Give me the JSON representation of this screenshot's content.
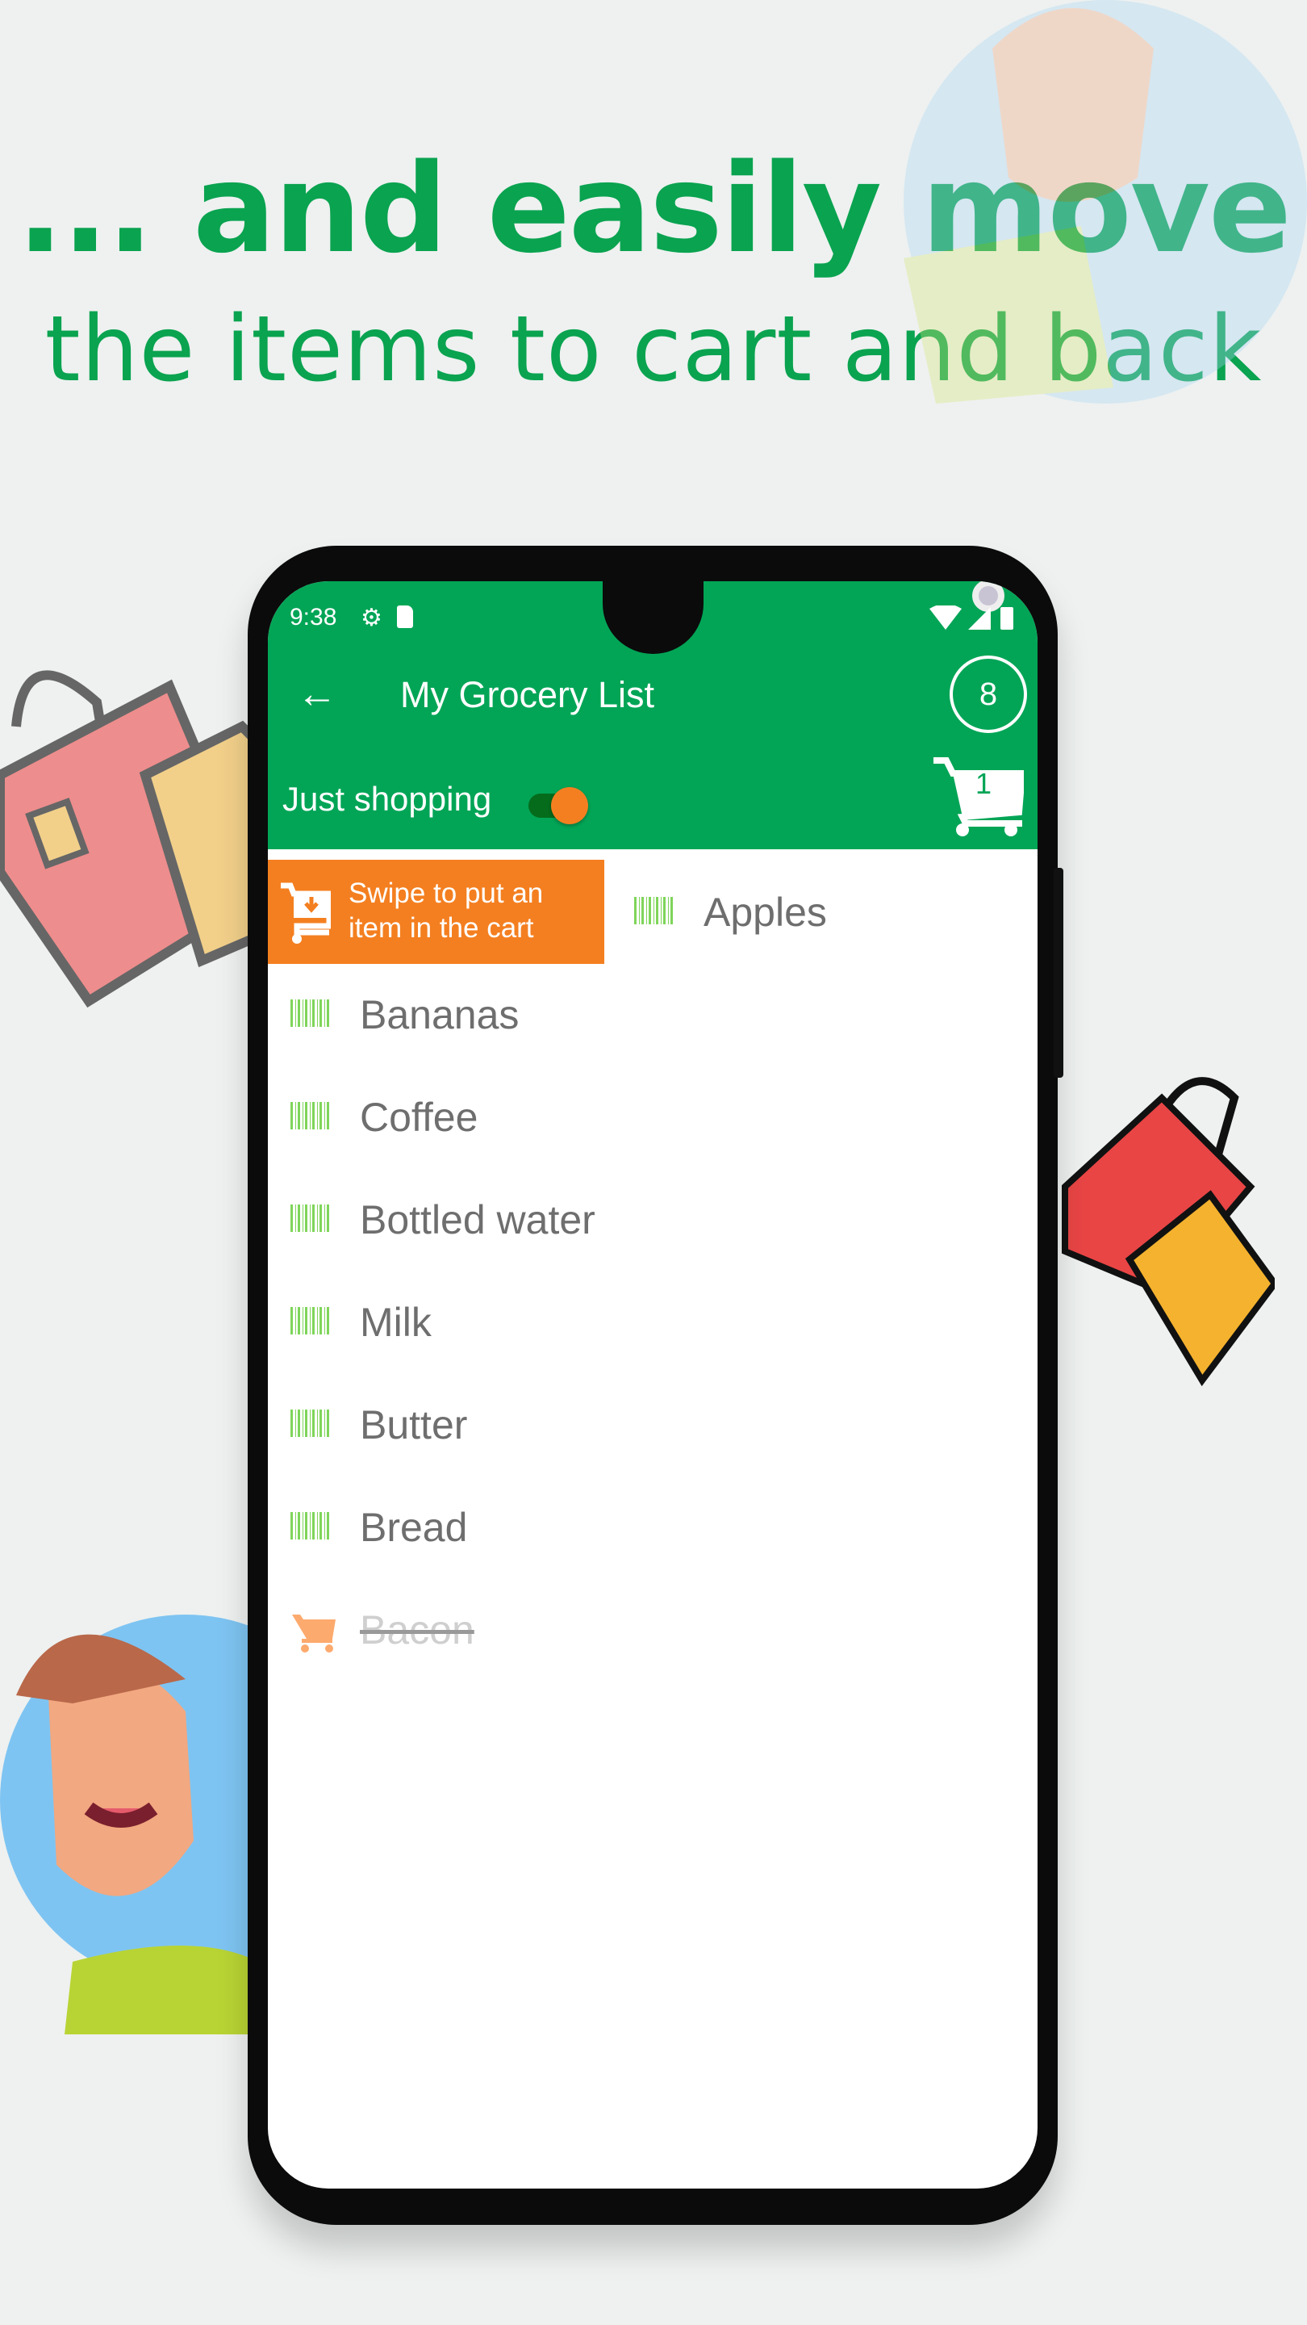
{
  "headline": {
    "line1": "... and easily move",
    "line2": "the items to cart and back"
  },
  "status": {
    "time": "9:38"
  },
  "toolbar": {
    "title": "My Grocery List",
    "count": "8",
    "cart_count": "1"
  },
  "mode": {
    "label": "Just shopping",
    "toggle_on": true
  },
  "swipe_hint": {
    "line1": "Swipe to put an",
    "line2": "item in the cart"
  },
  "items": [
    {
      "name": "Apples",
      "in_cart": false
    },
    {
      "name": "Bananas",
      "in_cart": false
    },
    {
      "name": "Coffee",
      "in_cart": false
    },
    {
      "name": "Bottled water",
      "in_cart": false
    },
    {
      "name": "Milk",
      "in_cart": false
    },
    {
      "name": "Butter",
      "in_cart": false
    },
    {
      "name": "Bread",
      "in_cart": false
    },
    {
      "name": "Bacon",
      "in_cart": true
    }
  ],
  "colors": {
    "brand": "#02a556",
    "accent": "#f47f20",
    "headline": "#0aa350"
  }
}
